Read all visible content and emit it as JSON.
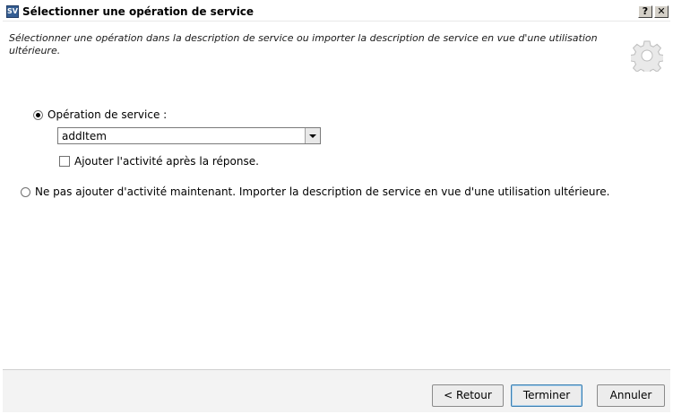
{
  "window": {
    "title": "Sélectionner une opération de service",
    "app_icon_text": "SV",
    "help_button": "?",
    "close_button": "✕"
  },
  "header": {
    "description": "Sélectionner une opération dans la description de service ou importer la description de service en vue d'une utilisation ultérieure.",
    "icon": "gear-icon"
  },
  "options": {
    "service_operation": {
      "label": "Opération de service :",
      "selected": true,
      "combo_value": "addItem",
      "add_activity_label": "Ajouter l'activité après la réponse.",
      "add_activity_checked": false
    },
    "import_later": {
      "label": "Ne pas ajouter d'activité maintenant. Importer la description de service en vue d'une utilisation ultérieure.",
      "selected": false
    }
  },
  "footer": {
    "back_label": "< Retour",
    "finish_label": "Terminer",
    "cancel_label": "Annuler"
  }
}
